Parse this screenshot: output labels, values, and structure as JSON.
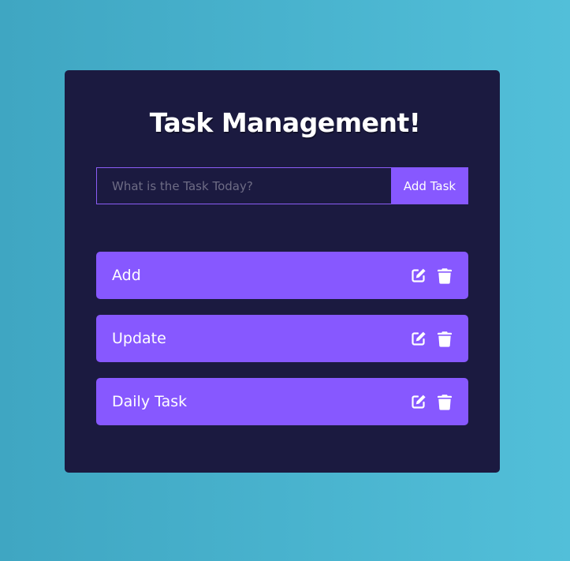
{
  "app": {
    "title": "Task Management!"
  },
  "form": {
    "input_value": "",
    "input_placeholder": "What is the Task Today?",
    "add_button_label": "Add Task"
  },
  "tasks": [
    {
      "label": "Add",
      "edit_icon": "edit-icon",
      "delete_icon": "trash-icon"
    },
    {
      "label": "Update",
      "edit_icon": "edit-icon",
      "delete_icon": "trash-icon"
    },
    {
      "label": "Daily Task",
      "edit_icon": "edit-icon",
      "delete_icon": "trash-icon"
    }
  ],
  "colors": {
    "background_start": "#3fa6c2",
    "background_end": "#52bfd9",
    "card": "#1b1a40",
    "accent": "#8758ff",
    "text": "#ffffff",
    "placeholder": "#6e6c85"
  }
}
